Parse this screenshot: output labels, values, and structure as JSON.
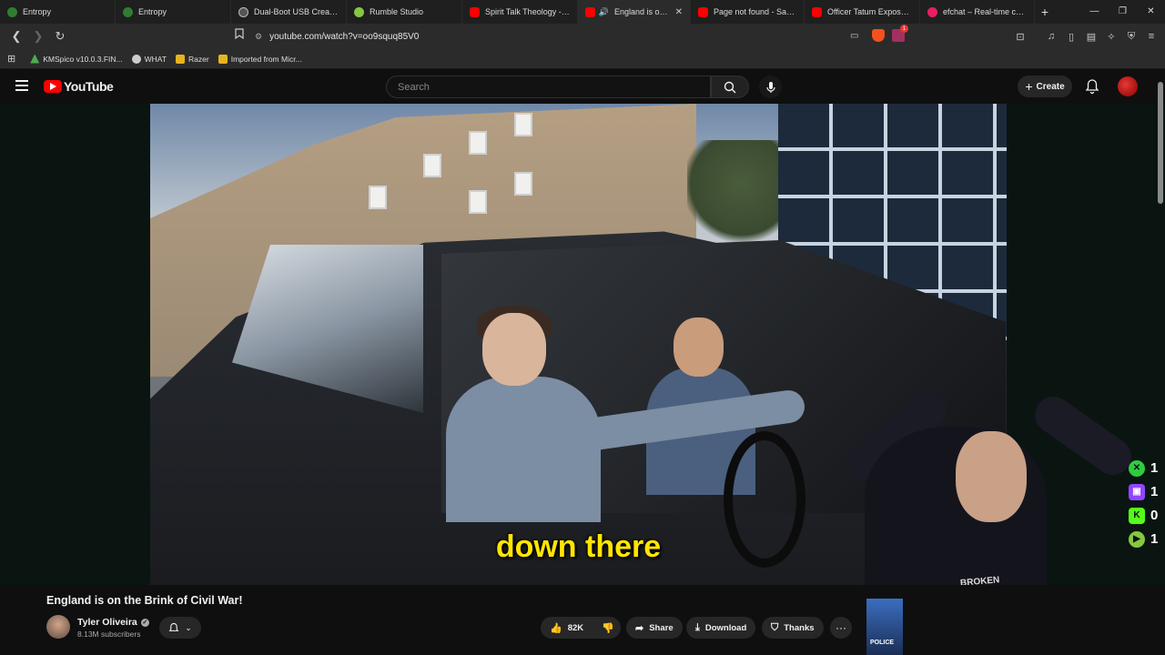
{
  "browser": {
    "tabs": [
      {
        "label": "Entropy",
        "color": "#2e7d32",
        "active": false
      },
      {
        "label": "Entropy",
        "color": "#2e7d32",
        "active": false
      },
      {
        "label": "Dual-Boot USB Creation G",
        "color": "#bbbbbb",
        "active": false
      },
      {
        "label": "Rumble Studio",
        "color": "#85c742",
        "active": false
      },
      {
        "label": "Spirit Talk Theology - YouT",
        "color": "#ff0000",
        "active": false
      },
      {
        "label": "England is on the B",
        "color": "#ff0000",
        "active": true
      },
      {
        "label": "Page not found - Sans Cor",
        "color": "#ff0000",
        "active": false
      },
      {
        "label": "Officer Tatum Exposes MA",
        "color": "#ff0000",
        "active": false
      },
      {
        "label": "efchat – Real-time chat, en",
        "color": "#e91e63",
        "active": false
      }
    ],
    "new_tab_label": "+",
    "window_controls": [
      "—",
      "❐",
      "✕"
    ],
    "url": "youtube.com/watch?v=oo9squq85V0",
    "bookmarks": [
      {
        "label": "KMSpico v10.0.3.FIN...",
        "color": "#4caf50"
      },
      {
        "label": "WHAT",
        "color": "#cccccc"
      },
      {
        "label": "Razer",
        "color": "#e6b422"
      },
      {
        "label": "Imported from Micr...",
        "color": "#e6b422"
      }
    ],
    "extension_badge": "1"
  },
  "youtube": {
    "logo_text": "YouTube",
    "search_placeholder": "Search",
    "create_label": "Create",
    "video": {
      "subtitle": "down there",
      "streamer_shirt_text": "BROKEN"
    },
    "stream_stats": [
      {
        "icon": "x-icon",
        "value": "1",
        "color": "#2ecc40"
      },
      {
        "icon": "twitch-icon",
        "value": "1",
        "color": "#9146ff"
      },
      {
        "icon": "kick-icon",
        "value": "0",
        "color": "#53fc18"
      },
      {
        "icon": "rumble-icon",
        "value": "1",
        "color": "#85c742"
      }
    ],
    "title": "England is on the Brink of Civil War!",
    "channel": {
      "name": "Tyler Oliveira",
      "subscribers": "8.13M subscribers"
    },
    "actions": {
      "likes": "82K",
      "share": "Share",
      "download": "Download",
      "thanks": "Thanks"
    },
    "thumb_label": "POLICE"
  },
  "colors": {
    "accent_red": "#ff0000",
    "subtitle_yellow": "#ffe600",
    "background": "#0f0f0f"
  }
}
